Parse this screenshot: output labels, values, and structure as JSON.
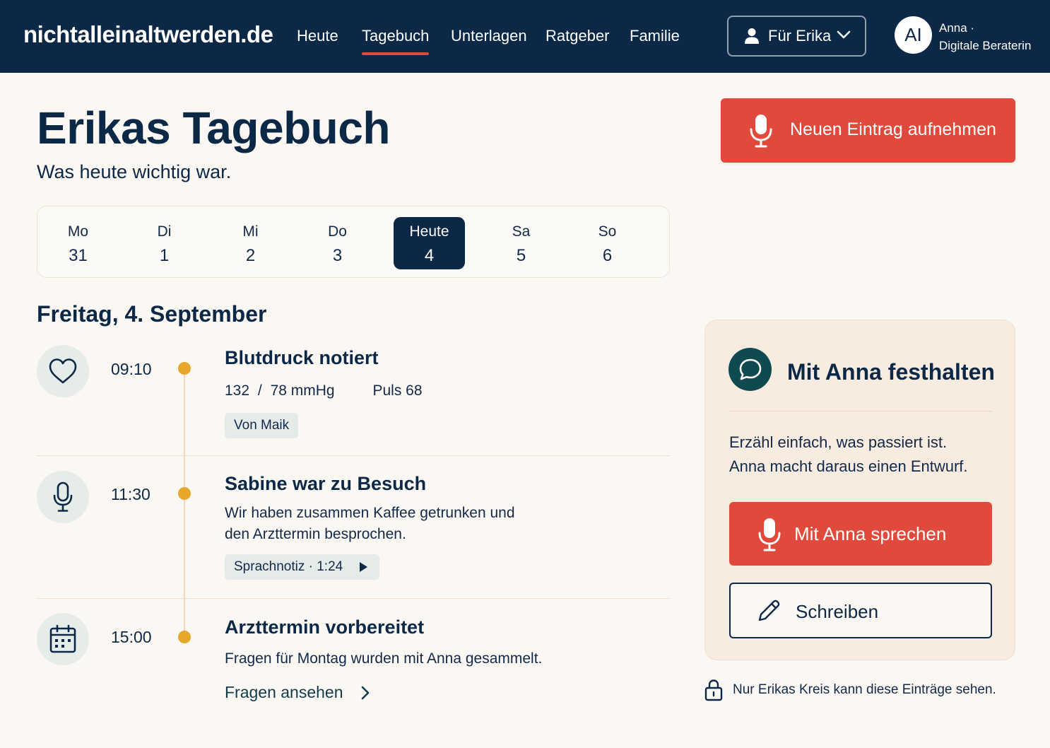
{
  "header": {
    "brand": "nichtalleinaltwerden.de",
    "nav": [
      "Heute",
      "Tagebuch",
      "Unterlagen",
      "Ratgeber",
      "Familie"
    ],
    "active_nav": "Tagebuch",
    "person_select": {
      "label": "Für Erika",
      "icon": "user-icon"
    },
    "user": {
      "initials": "AI",
      "name": "Anna ·",
      "role": "Digitale Beraterin"
    }
  },
  "page": {
    "title": "Erikas Tagebuch",
    "subtitle": "Was heute wichtig war.",
    "record_button": "Neuen Eintrag aufnehmen"
  },
  "week": [
    {
      "day": "Mo",
      "date": "31",
      "selected": false
    },
    {
      "day": "Di",
      "date": "1",
      "selected": false
    },
    {
      "day": "Mi",
      "date": "2",
      "selected": false
    },
    {
      "day": "Do",
      "date": "3",
      "selected": false
    },
    {
      "day": "Heute",
      "date": "4",
      "selected": true
    },
    {
      "day": "Sa",
      "date": "5",
      "selected": false
    },
    {
      "day": "So",
      "date": "6",
      "selected": false
    }
  ],
  "date_heading": "Freitag, 4. September",
  "entries": [
    {
      "icon": "heart-icon",
      "time": "09:10",
      "title": "Blutdruck notiert",
      "values": {
        "systolic": "132",
        "sep": "/",
        "diastolic": "78",
        "unit": "mmHg",
        "pulse": "Puls 68"
      },
      "chip": "Von Maik"
    },
    {
      "icon": "microphone-icon",
      "time": "11:30",
      "title": "Sabine war zu Besuch",
      "text": [
        "Wir haben zusammen Kaffee getrunken und",
        "den Arzttermin besprochen."
      ],
      "chip": "Sprachnotiz · 1:24"
    },
    {
      "icon": "calendar-icon",
      "time": "15:00",
      "title": "Arzttermin vorbereitet",
      "text": [
        "Fragen für Montag wurden mit Anna gesammelt."
      ],
      "link": "Fragen ansehen"
    }
  ],
  "assistant_panel": {
    "title": "Mit Anna festhalten",
    "text": [
      "Erzähl einfach, was passiert ist.",
      "Anna macht daraus einen Entwurf."
    ],
    "speak_button": "Mit Anna sprechen",
    "write_button": "Schreiben"
  },
  "privacy_note": "Nur Erikas Kreis kann diese Einträge sehen.",
  "colors": {
    "navy": "#0c2847",
    "accent_red": "#e04a3c",
    "timeline_dot": "#e6a72a",
    "panel_bg": "#f8ece0",
    "page_bg": "#fbf8f3",
    "teal": "#0f4a50"
  }
}
